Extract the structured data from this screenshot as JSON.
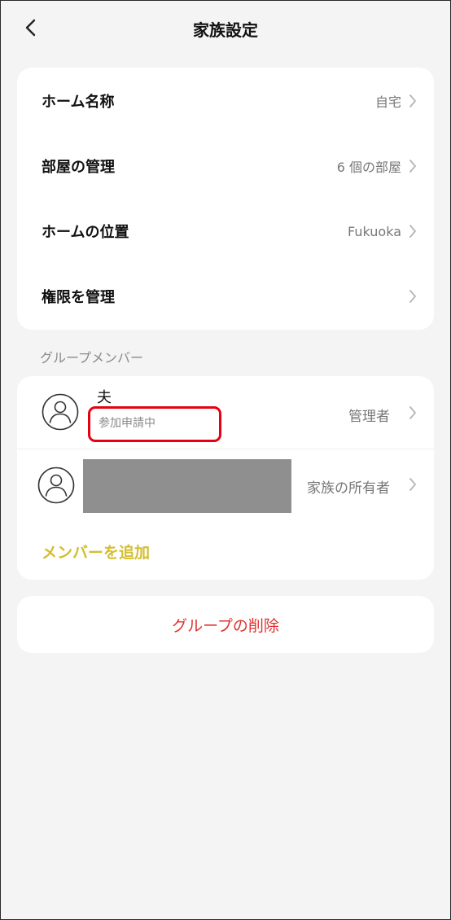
{
  "header": {
    "title": "家族設定"
  },
  "settings": [
    {
      "label": "ホーム名称",
      "value": "自宅"
    },
    {
      "label": "部屋の管理",
      "value": "6 個の部屋"
    },
    {
      "label": "ホームの位置",
      "value": "Fukuoka"
    },
    {
      "label": "権限を管理",
      "value": ""
    }
  ],
  "members_section": {
    "title": "グループメンバー",
    "members": [
      {
        "name": "夫",
        "status": "参加申請中",
        "role": "管理者"
      },
      {
        "name": "",
        "status": "",
        "role": "家族の所有者"
      }
    ],
    "add_label": "メンバーを追加"
  },
  "delete_group": {
    "label": "グループの削除"
  },
  "colors": {
    "accent_yellow": "#d4be2e",
    "danger_red": "#e0312f",
    "highlight_red": "#e60012"
  }
}
